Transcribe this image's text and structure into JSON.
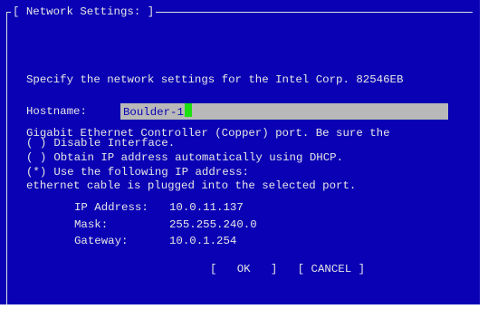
{
  "colors": {
    "background": "#0a00b4",
    "text": "#e6e6e6",
    "field_background": "#b9b9b9",
    "cursor": "#1ee010"
  },
  "dialog": {
    "title": "[ Network Settings: ]",
    "description_lines": [
      "Specify the network settings for the Intel Corp. 82546EB",
      "Gigabit Ethernet Controller (Copper) port. Be sure the",
      "ethernet cable is plugged into the selected port."
    ]
  },
  "hostname": {
    "label": "Hostname:",
    "value": "Boulder-1"
  },
  "options": [
    {
      "marker": "( )",
      "label": "Disable Interface.",
      "selected": false
    },
    {
      "marker": "( )",
      "label": "Obtain IP address automatically using DHCP.",
      "selected": false
    },
    {
      "marker": "(*)",
      "label": "Use the following IP address:",
      "selected": true
    }
  ],
  "ip_settings": [
    {
      "label": "IP Address:",
      "value": "10.0.11.137"
    },
    {
      "label": "Mask:",
      "value": "255.255.240.0"
    },
    {
      "label": "Gateway:",
      "value": "10.0.1.254"
    }
  ],
  "buttons": {
    "ok_label": "[   OK   ]",
    "cancel_label": "[ CANCEL ]"
  }
}
